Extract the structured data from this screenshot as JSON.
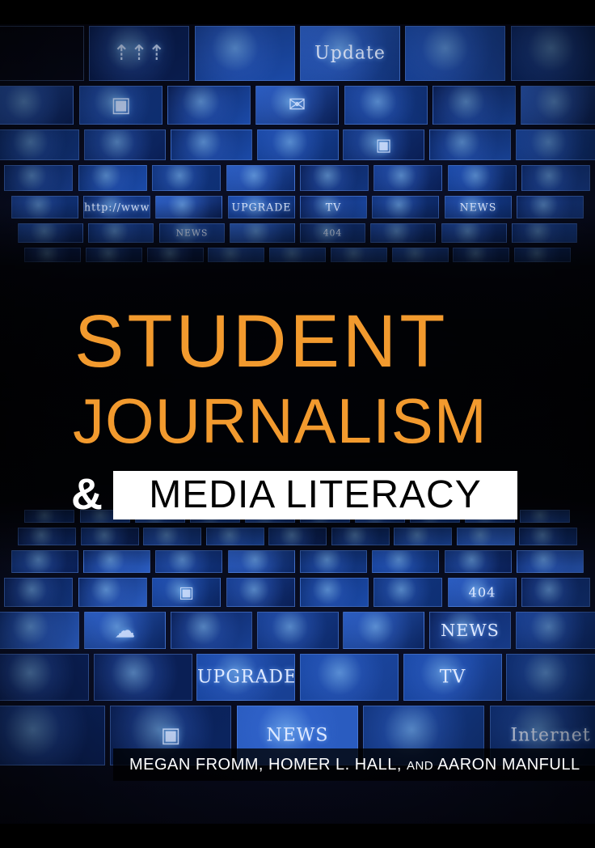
{
  "cover": {
    "title_line1": "STUDENT",
    "title_line2": "JOURNALISM",
    "ampersand": "&",
    "subtitle": "MEDIA LITERACY",
    "authors_part1": "MEGAN FROMM, HOMER L. HALL, ",
    "authors_and": "AND",
    "authors_part2": " AARON MANFULL"
  },
  "screen_texts": {
    "update": "Update",
    "http": "http://www.",
    "upgrade": "UPGRADE",
    "news": "NEWS",
    "error_404": "404",
    "tv": "TV",
    "internet": "Internet"
  },
  "colors": {
    "title": "#f29a2e",
    "subtitle_bg": "#ffffff",
    "screen_glow": "#3a6fd8"
  }
}
